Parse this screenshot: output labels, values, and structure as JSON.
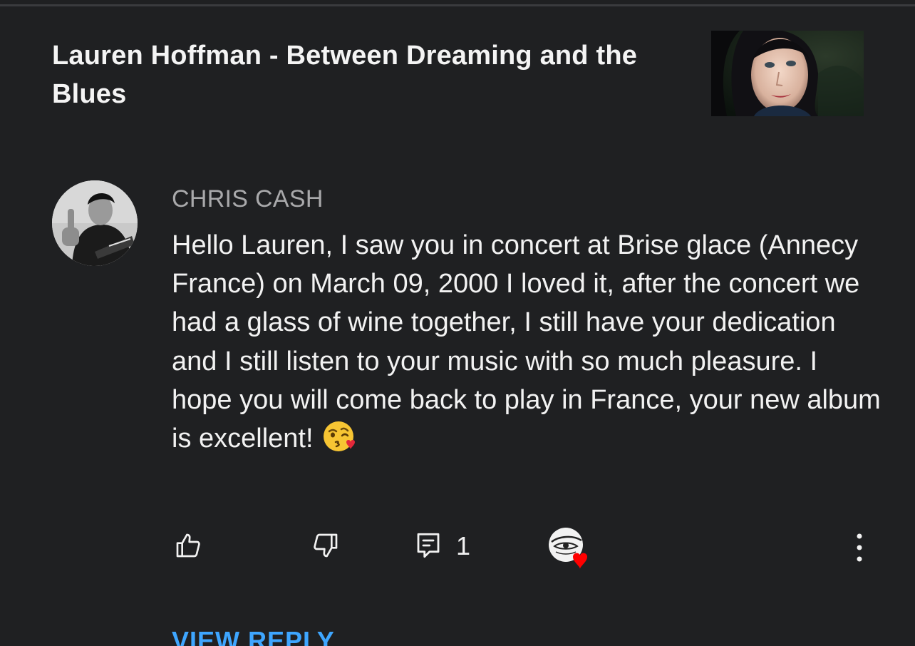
{
  "video": {
    "title": "Lauren Hoffman - Between Dreaming and the Blues",
    "thumbnail_icon": "video-thumbnail"
  },
  "comment": {
    "author": "CHRIS CASH",
    "text": "Hello Lauren, I saw you in concert at Brise glace (Annecy France) on March 09, 2000 I loved it, after the concert we had a glass of wine together, I still have your dedication and I still listen to your music with so much pleasure. I hope you will come back to play in France, your new album is excellent!",
    "emoji": "😘",
    "reply_count": "1",
    "view_replies_label": "VIEW REPLY"
  },
  "icons": {
    "like": "thumbs-up-icon",
    "dislike": "thumbs-down-icon",
    "reply": "reply-icon",
    "creator_heart": "creator-heart-icon",
    "more": "more-vertical-icon"
  },
  "colors": {
    "background": "#1f2022",
    "text": "#f2f2f2",
    "author": "#a9a9ab",
    "accent": "#3ea6ff",
    "heart": "#ff0000"
  }
}
